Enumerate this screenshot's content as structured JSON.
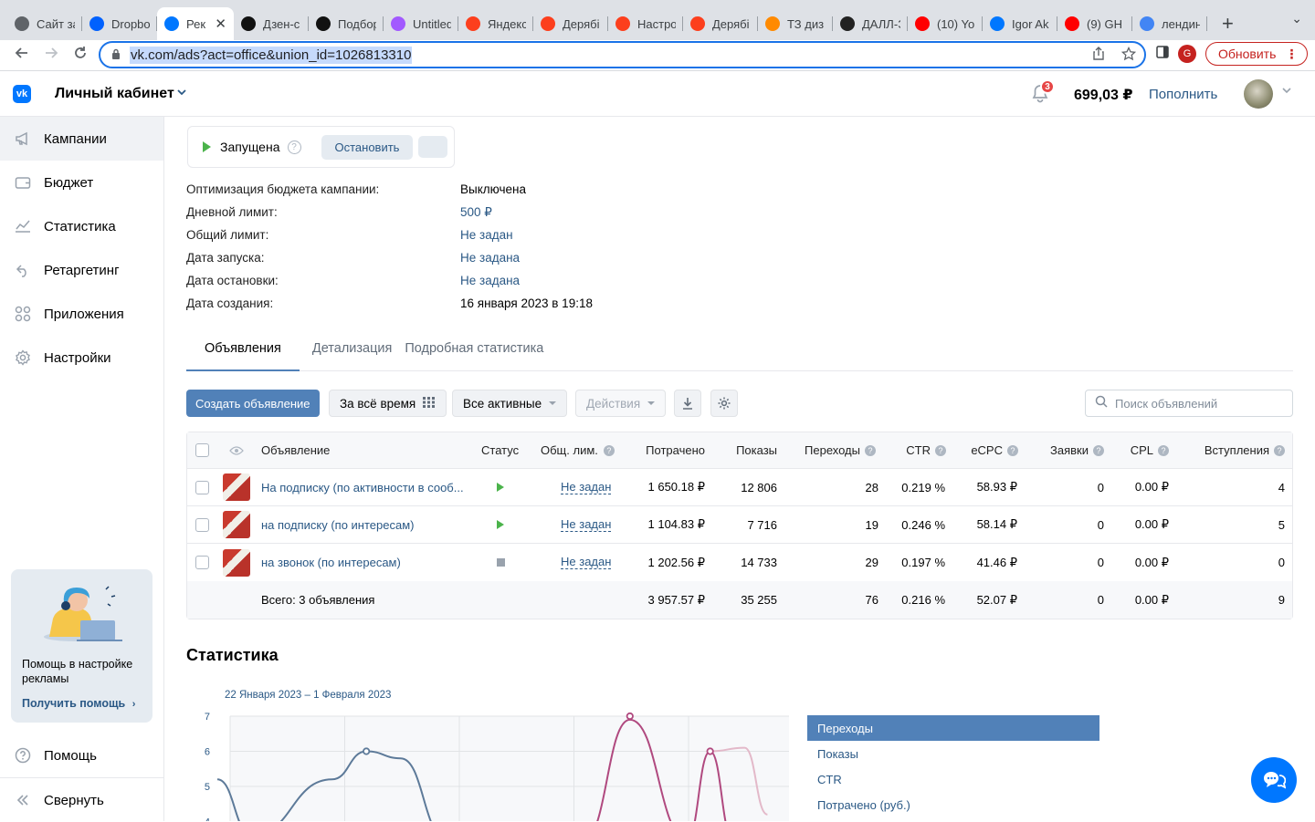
{
  "browser": {
    "tabs": [
      {
        "label": "Сайт за",
        "fav_color": "#5f6368"
      },
      {
        "label": "Dropbo",
        "fav_color": "#0061fe"
      },
      {
        "label": "Рек",
        "fav_color": "#0077ff",
        "active": true
      },
      {
        "label": "Дзен-с",
        "fav_color": "#111111"
      },
      {
        "label": "Подбор",
        "fav_color": "#111111"
      },
      {
        "label": "Untitled",
        "fav_color": "#a259ff"
      },
      {
        "label": "Яндекс",
        "fav_color": "#fc3f1d"
      },
      {
        "label": "Дерябі",
        "fav_color": "#fc3f1d"
      },
      {
        "label": "Настро",
        "fav_color": "#fc3f1d"
      },
      {
        "label": "Дерябі",
        "fav_color": "#fc3f1d"
      },
      {
        "label": "ТЗ диз",
        "fav_color": "#ff8a00"
      },
      {
        "label": "ДАЛЛ-Э",
        "fav_color": "#222222"
      },
      {
        "label": "(10) Yo",
        "fav_color": "#ff0000"
      },
      {
        "label": "Igor Ak",
        "fav_color": "#0077ff"
      },
      {
        "label": "(9) GH",
        "fav_color": "#ff0000"
      },
      {
        "label": "лендин",
        "fav_color": "#4285f4"
      }
    ],
    "url": "vk.com/ads?act=office&union_id=1026813310",
    "profile_letter": "G",
    "update_label": "Обновить"
  },
  "header": {
    "title": "Личный кабинет",
    "notifications": "3",
    "balance": "699,03 ₽",
    "topup": "Пополнить"
  },
  "sidebar": {
    "items": [
      {
        "label": "Кампании",
        "icon": "megaphone-icon"
      },
      {
        "label": "Бюджет",
        "icon": "wallet-icon"
      },
      {
        "label": "Статистика",
        "icon": "chart-icon"
      },
      {
        "label": "Ретаргетинг",
        "icon": "retarget-icon"
      },
      {
        "label": "Приложения",
        "icon": "apps-icon"
      },
      {
        "label": "Настройки",
        "icon": "gear-icon"
      }
    ],
    "help_card": {
      "text": "Помощь в настройке рекламы",
      "link": "Получить помощь"
    },
    "help": "Помощь",
    "collapse": "Свернуть"
  },
  "campaign": {
    "status": "Запущена",
    "stop_button": "Остановить",
    "props": [
      {
        "label": "Оптимизация бюджета кампании:",
        "value": "Выключена",
        "link": false
      },
      {
        "label": "Дневной лимит:",
        "value": "500 ₽",
        "link": true
      },
      {
        "label": "Общий лимит:",
        "value": "Не задан",
        "link": true
      },
      {
        "label": "Дата запуска:",
        "value": "Не задана",
        "link": true
      },
      {
        "label": "Дата остановки:",
        "value": "Не задана",
        "link": true
      },
      {
        "label": "Дата создания:",
        "value": "16 января 2023 в 19:18",
        "link": false
      }
    ]
  },
  "tabs": [
    "Объявления",
    "Детализация",
    "Подробная статистика"
  ],
  "toolbar": {
    "create": "Создать объявление",
    "period": "За всё время",
    "filter": "Все активные",
    "actions": "Действия",
    "search_placeholder": "Поиск объявлений"
  },
  "table": {
    "headers": {
      "ad": "Объявление",
      "status": "Статус",
      "limit": "Общ. лим.",
      "spent": "Потрачено",
      "impressions": "Показы",
      "clicks": "Переходы",
      "ctr": "CTR",
      "ecpc": "eCPC",
      "leads": "Заявки",
      "cpl": "CPL",
      "joins": "Вступления"
    },
    "rows": [
      {
        "name": "На подписку (по активности в сооб...",
        "status": "running",
        "limit": "Не задан",
        "spent": "1 650.18 ₽",
        "impressions": "12 806",
        "clicks": "28",
        "ctr": "0.219 %",
        "ecpc": "58.93 ₽",
        "leads": "0",
        "cpl": "0.00 ₽",
        "joins": "4"
      },
      {
        "name": "на подписку (по интересам)",
        "status": "running",
        "limit": "Не задан",
        "spent": "1 104.83 ₽",
        "impressions": "7 716",
        "clicks": "19",
        "ctr": "0.246 %",
        "ecpc": "58.14 ₽",
        "leads": "0",
        "cpl": "0.00 ₽",
        "joins": "5"
      },
      {
        "name": "на звонок (по интересам)",
        "status": "stopped",
        "limit": "Не задан",
        "spent": "1 202.56 ₽",
        "impressions": "14 733",
        "clicks": "29",
        "ctr": "0.197 %",
        "ecpc": "41.46 ₽",
        "leads": "0",
        "cpl": "0.00 ₽",
        "joins": "0"
      }
    ],
    "total": {
      "label": "Всего: 3 объявления",
      "spent": "3 957.57 ₽",
      "impressions": "35 255",
      "clicks": "76",
      "ctr": "0.216 %",
      "ecpc": "52.07 ₽",
      "leads": "0",
      "cpl": "0.00 ₽",
      "joins": "9"
    }
  },
  "stats": {
    "title": "Статистика",
    "date_range": "22 Января 2023 – 1 Февраля 2023",
    "legend": [
      "Переходы",
      "Показы",
      "CTR",
      "Потрачено (руб.)"
    ]
  },
  "chart_data": {
    "type": "line",
    "yticks": [
      "7",
      "6",
      "5",
      "4"
    ],
    "ylim": [
      4,
      7
    ],
    "series": [
      {
        "color": "#5d7a99",
        "points": [
          [
            0,
            5.2
          ],
          [
            0.3,
            3.6
          ],
          [
            1.0,
            5.2
          ],
          [
            1.3,
            6.0
          ],
          [
            1.6,
            5.8
          ],
          [
            2.0,
            3.5
          ]
        ]
      },
      {
        "color": "#b0497f",
        "points": [
          [
            3.2,
            3.5
          ],
          [
            3.6,
            6.9
          ],
          [
            4.1,
            3.5
          ]
        ]
      },
      {
        "color": "#b0497f",
        "points": [
          [
            4.1,
            3.5
          ],
          [
            4.3,
            6.0
          ],
          [
            4.5,
            3.5
          ]
        ]
      },
      {
        "color": "#e3b9c9",
        "points": [
          [
            4.3,
            6.0
          ],
          [
            4.6,
            6.1
          ],
          [
            4.8,
            4.2
          ]
        ]
      }
    ],
    "markers": [
      {
        "color": "#5d7a99",
        "x": 1.3,
        "y": 6.0
      },
      {
        "color": "#b0497f",
        "x": 3.6,
        "y": 7.0
      },
      {
        "color": "#b0497f",
        "x": 4.3,
        "y": 6.0
      }
    ]
  }
}
